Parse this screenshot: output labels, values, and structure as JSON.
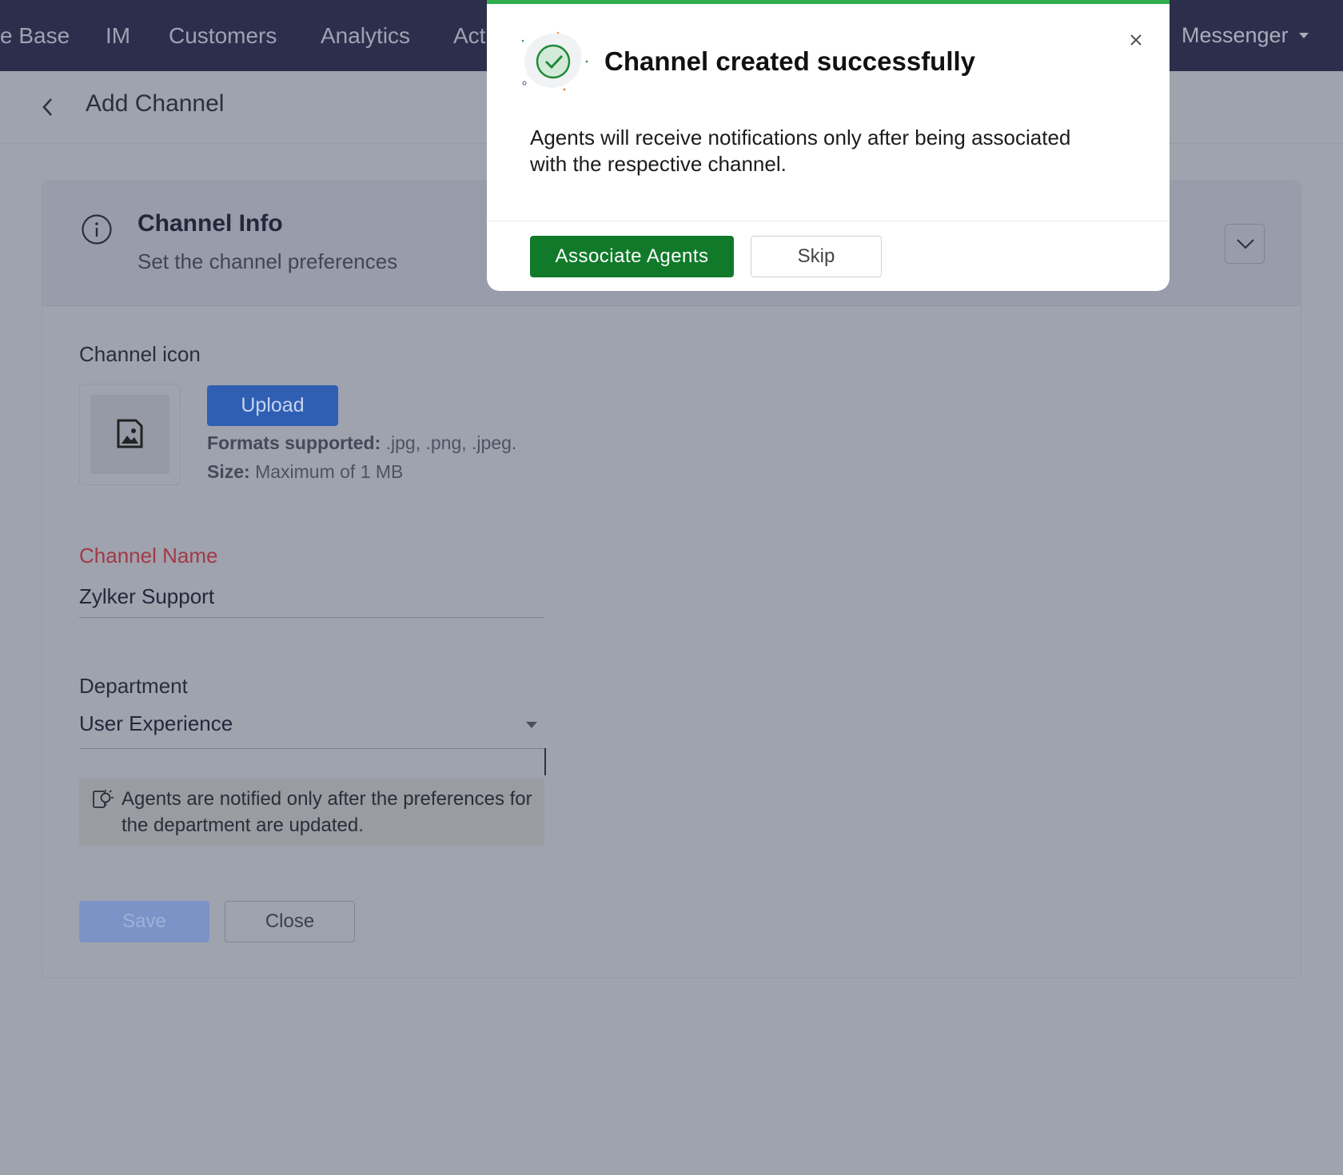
{
  "topnav": {
    "tabs": [
      "e Base",
      "IM",
      "Customers",
      "Analytics",
      "Act"
    ],
    "right_menu": "Messenger"
  },
  "header": {
    "title": "Add Channel"
  },
  "card": {
    "title": "Channel Info",
    "subtitle": "Set the channel preferences"
  },
  "form": {
    "icon_label": "Channel icon",
    "upload_label": "Upload",
    "formats_key": "Formats supported:",
    "formats_value": " .jpg, .png, .jpeg.",
    "size_key": "Size:",
    "size_value": " Maximum of 1 MB",
    "channel_name_label": "Channel Name",
    "channel_name_value": "Zylker Support",
    "department_label": "Department",
    "department_value": "User Experience",
    "notice": "Agents are notified only after the preferences for the department are updated.",
    "save_label": "Save",
    "close_label": "Close"
  },
  "modal": {
    "title": "Channel created successfully",
    "body": "Agents will receive notifications only after being associated with the respective channel.",
    "primary_label": "Associate Agents",
    "secondary_label": "Skip"
  },
  "colors": {
    "nav_bg": "#2b2f4c",
    "overlay_bg": "#9fa3ae",
    "success_green": "#117a2a",
    "upload_blue": "#2f5fb3",
    "required_red": "#a13a47"
  }
}
